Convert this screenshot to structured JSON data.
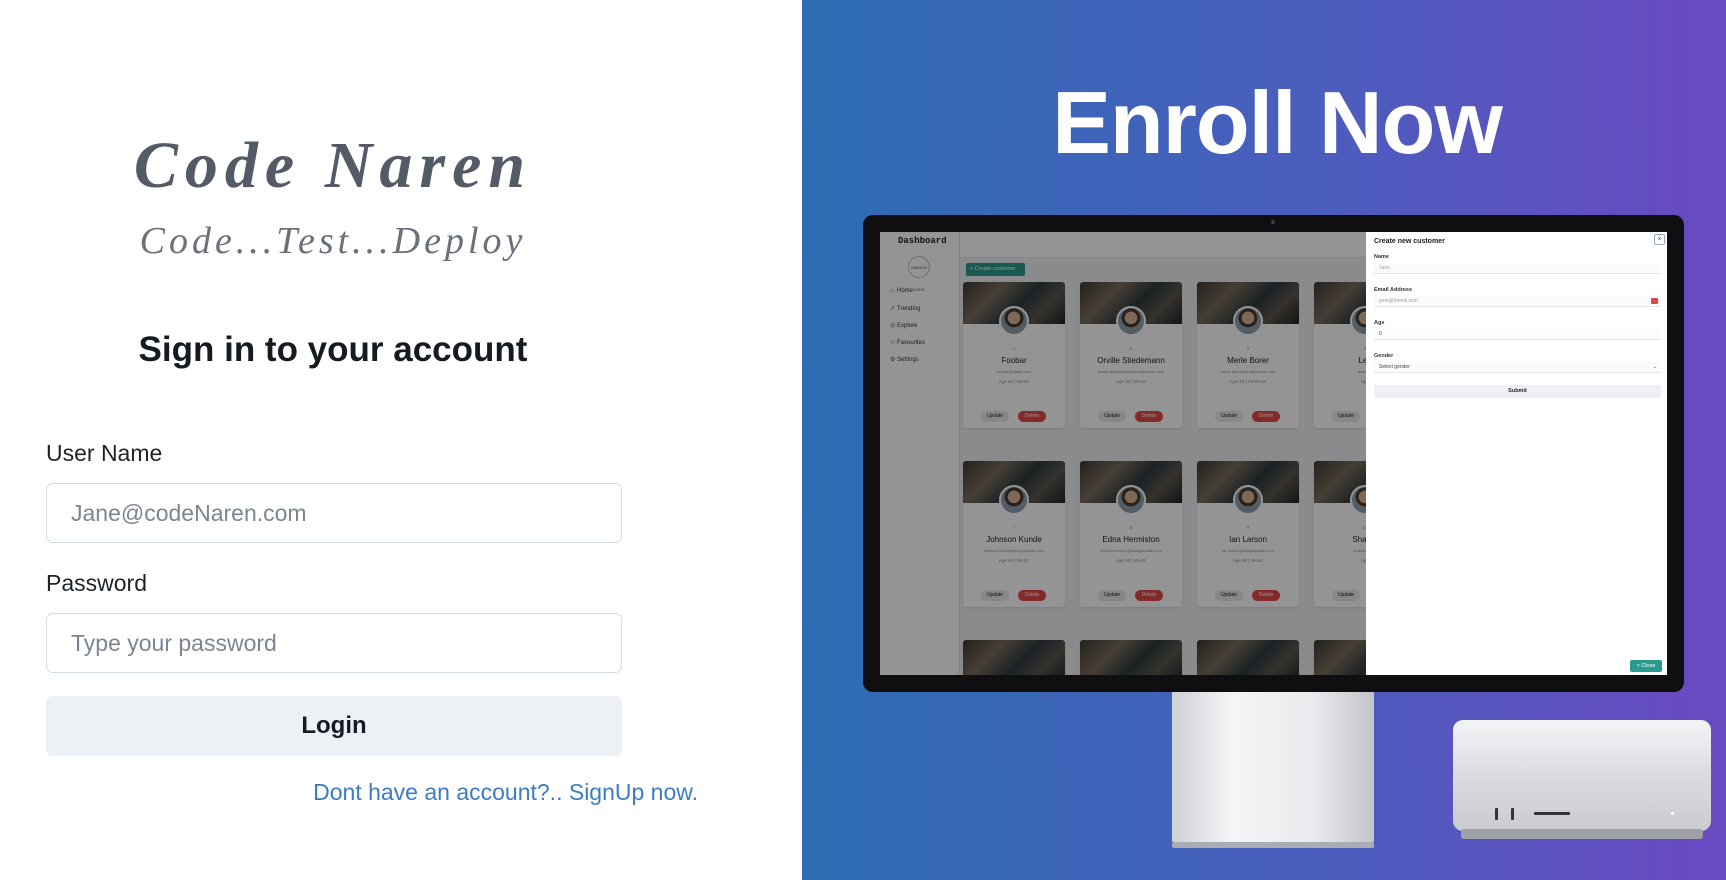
{
  "login": {
    "brand_title": "Code Naren",
    "brand_tagline": "Code...Test...Deploy",
    "heading": "Sign in to your account",
    "username_label": "User Name",
    "username_placeholder": "Jane@codeNaren.com",
    "password_label": "Password",
    "password_placeholder": "Type your password",
    "login_button": "Login",
    "signup_link": "Dont have an account?.. SignUp now."
  },
  "promo": {
    "title": "Enroll Now",
    "colors": {
      "gradient_start": "#2d6db4",
      "gradient_end": "#6a49c1"
    },
    "dashboard": {
      "title": "Dashboard",
      "logo_text": "AMIGOS CODE",
      "nav": [
        {
          "icon": "home-icon",
          "label": "Home"
        },
        {
          "icon": "trending-icon",
          "label": "Trending"
        },
        {
          "icon": "compass-icon",
          "label": "Explore"
        },
        {
          "icon": "star-icon",
          "label": "Favourites"
        },
        {
          "icon": "gear-icon",
          "label": "Settings"
        }
      ],
      "create_button": "+ Create customer",
      "cards": [
        {
          "num": "1",
          "name": "Foobar",
          "email": "foobar@gmail.com",
          "meta": "Age 60 | MALE",
          "update": "Update",
          "delete": "Delete"
        },
        {
          "num": "2",
          "name": "Orville Stiedemann",
          "email": "orville.stiedemann@amigoscode.com",
          "meta": "Age 30 | MALE",
          "update": "Update",
          "delete": "Delete"
        },
        {
          "num": "3",
          "name": "Merle Borer",
          "email": "merle.borer@amigoscode.com",
          "meta": "Age 23 | FEMALE",
          "update": "Update",
          "delete": "Delete"
        },
        {
          "num": "4",
          "name": "Lec",
          "email": "lesa.rec",
          "meta": "Age",
          "update": "Update",
          "delete": ""
        },
        {
          "num": "7",
          "name": "Johnson Kunde",
          "email": "johnson.kunde@amigoscode.com",
          "meta": "Age 64 | MALE",
          "update": "Update",
          "delete": "Delete"
        },
        {
          "num": "8",
          "name": "Edna Hermiston",
          "email": "edna.hermiston@amigoscode.com",
          "meta": "Age 50 | MALE",
          "update": "Update",
          "delete": "Delete"
        },
        {
          "num": "9",
          "name": "Ian Larson",
          "email": "ian.larson@amigoscode.com",
          "meta": "Age 52 | MALE",
          "update": "Update",
          "delete": "Delete"
        },
        {
          "num": "10",
          "name": "Shante",
          "email": "shantell.dicki",
          "meta": "Age",
          "update": "Update",
          "delete": ""
        }
      ],
      "drawer": {
        "title": "Create new customer",
        "close_x": "×",
        "name_label": "Name",
        "name_placeholder": "Jane",
        "email_label": "Email Address",
        "email_placeholder": "jane@formik.com",
        "age_label": "Age",
        "age_value": "0",
        "gender_label": "Gender",
        "gender_value": "Select gender",
        "submit": "Submit",
        "close_button": "× Close"
      }
    }
  }
}
